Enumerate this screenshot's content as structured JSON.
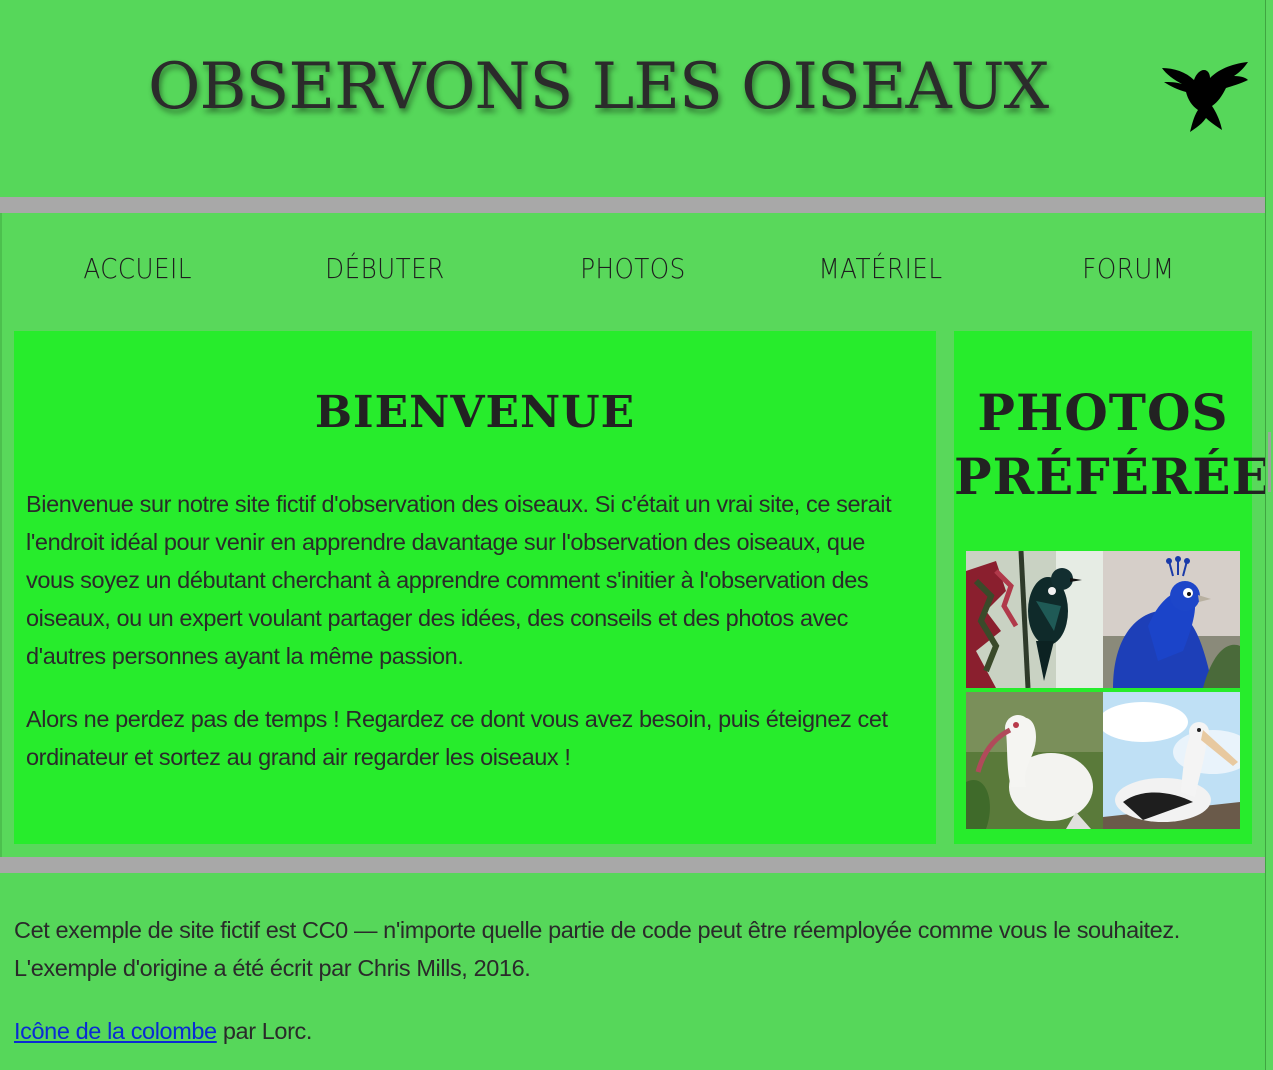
{
  "header": {
    "title": "Observons les oiseaux",
    "logo_icon": "dove-icon"
  },
  "nav": {
    "items": [
      {
        "label": "ACCUEIL"
      },
      {
        "label": "DÉBUTER"
      },
      {
        "label": "PHOTOS"
      },
      {
        "label": "MATÉRIEL"
      },
      {
        "label": "FORUM"
      }
    ]
  },
  "main": {
    "heading": "Bienvenue",
    "paragraphs": [
      "Bienvenue sur notre site fictif d'observation des oiseaux. Si c'était un vrai site, ce serait l'endroit idéal pour venir en apprendre davantage sur l'observation des oiseaux, que vous soyez un débutant cherchant à apprendre comment s'initier à l'observation des oiseaux, ou un expert voulant partager des idées, des conseils et des photos avec d'autres personnes ayant la même passion.",
      "Alors ne perdez pas de temps ! Regardez ce dont vous avez besoin, puis éteignez cet ordinateur et sortez au grand air regarder les oiseaux !"
    ]
  },
  "sidebar": {
    "heading": "Photos préférées",
    "photos": [
      "tui-photo",
      "peacock-photo",
      "ibis-photo",
      "pelican-photo"
    ]
  },
  "footer": {
    "license_text": "Cet exemple de site fictif est CC0 — n'importe quelle partie de code peut être réemployée comme vous le souhaitez. L'exemple d'origine a été écrit par Chris Mills, 2016.",
    "credit_link": "Icône de la colombe",
    "credit_suffix": " par Lorc."
  },
  "colors": {
    "page_bg": "#59d85b",
    "panel_bg": "#27ec2c",
    "separator": "#a8a8a8",
    "link": "#0a2bd4"
  }
}
